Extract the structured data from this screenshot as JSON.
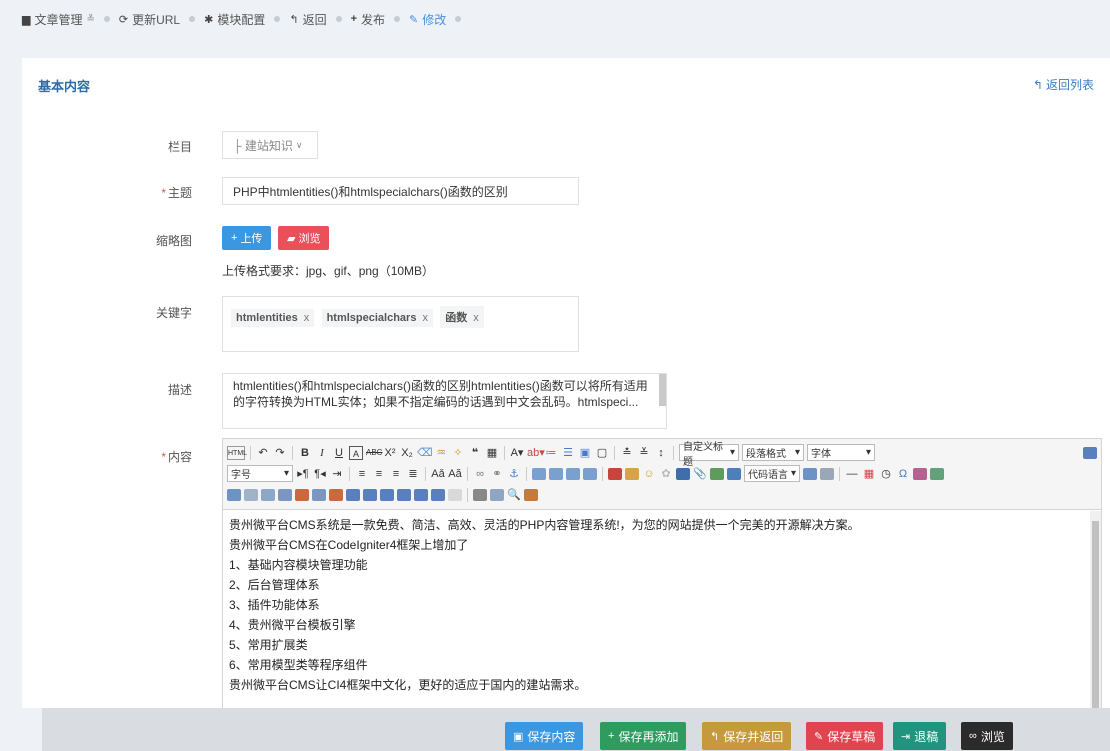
{
  "breadcrumb": {
    "article_mgmt": "文章管理",
    "update_url": "更新URL",
    "module_config": "模块配置",
    "back": "返回",
    "publish": "发布",
    "edit": "修改"
  },
  "card": {
    "title": "基本内容",
    "back_list": "返回列表"
  },
  "form": {
    "column_label": "栏目",
    "column_value": "├ 建站知识",
    "subject_label": "主题",
    "subject_value": "PHP中htmlentities()和htmlspecialchars()函数的区别",
    "thumb_label": "缩略图",
    "upload_label": "上传",
    "browse_label": "浏览",
    "thumb_hint": "上传格式要求：jpg、gif、png（10MB）",
    "keywords_label": "关键字",
    "keywords": [
      "htmlentities",
      "htmlspecialchars",
      "函数"
    ],
    "desc_label": "描述",
    "desc_value": "htmlentities()和htmlspecialchars()函数的区别htmlentities()函数可以将所有适用的字符转换为HTML实体；如果不指定编码的话遇到中文会乱码。htmlspeci...",
    "content_label": "内容"
  },
  "editor": {
    "toolbar_selects": {
      "custom_title": "自定义标题",
      "paragraph": "段落格式",
      "font": "字体",
      "size": "字号",
      "code_lang": "代码语言"
    },
    "lines": [
      "贵州微平台CMS系统是一款免费、简洁、高效、灵活的PHP内容管理系统!，为您的网站提供一个完美的开源解决方案。",
      "贵州微平台CMS在CodeIgniter4框架上增加了",
      "1、基础内容模块管理功能",
      "2、后台管理体系",
      "3、插件功能体系",
      "4、贵州微平台模板引擎",
      "5、常用扩展类",
      "6、常用模型类等程序组件",
      "贵州微平台CMS让CI4框架中文化，更好的适应于国内的建站需求。"
    ]
  },
  "footer": {
    "save": "保存内容",
    "save_add": "保存再添加",
    "save_back": "保存并返回",
    "save_draft": "保存草稿",
    "reject": "退稿",
    "preview": "浏览"
  }
}
